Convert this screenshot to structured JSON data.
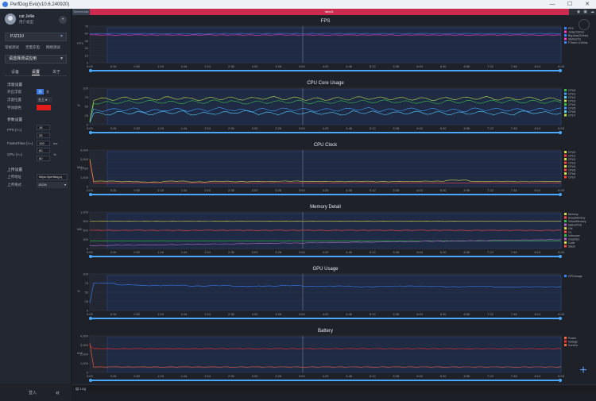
{
  "window": {
    "title": "PerfDog Evo(v10.6.240920)",
    "controls": [
      "—",
      "☐",
      "✕"
    ]
  },
  "user": {
    "name": "cat Jellie",
    "type": "用户类型"
  },
  "device": {
    "name": "PJZ110"
  },
  "modes": [
    "常规测试",
    "无需充电",
    "网络测试"
  ],
  "app_select": "请选择测试应用",
  "tabs": [
    "设备",
    "设置",
    "关于"
  ],
  "settings": {
    "float_section": "浮窗设置",
    "open_float": "开启浮窗",
    "on_label": "开",
    "off_label": "关",
    "float_pos": "浮窗位置",
    "float_pos_value": "左上",
    "font_color": "字体颜色",
    "font_color_value": "#e21b1b",
    "params_section": "参数设置",
    "fps_label": "FPS (>=)",
    "fps_value1": "18",
    "fps_value2": "25",
    "frametime_label": "FrameTime (>=)",
    "frametime_value": "100",
    "frametime_unit": "ms",
    "cpu_label": "CPU (>=)",
    "cpu_value1": "60",
    "cpu_value2": "80",
    "cpu_unit": "%",
    "upload_section": "上传设置",
    "upload_addr": "上传地址",
    "upload_addr_value": "https://perfdog.q",
    "upload_fmt": "上传格式",
    "upload_fmt_value": "JSON"
  },
  "bottom": {
    "login": "登入",
    "collapse": "«"
  },
  "toptabs": {
    "first": "Screen1ab",
    "second": "label1"
  },
  "status": {
    "log": "Log"
  },
  "time_ticks": [
    "0:00",
    "0:26",
    "0:52",
    "1:18",
    "1:44",
    "2:10",
    "2:36",
    "3:02",
    "3:28",
    "3:54",
    "4:20",
    "4:46",
    "5:12",
    "5:38",
    "6:04",
    "6:30",
    "6:56",
    "7:22",
    "7:48",
    "8:14",
    "8:28"
  ],
  "colors": {
    "accent": "#3b7be0",
    "danger": "#cc2a4e",
    "cursor_bar": "#4aa8ff"
  },
  "chart_data": [
    {
      "type": "line",
      "title": "FPS",
      "ylabel": "FPS",
      "ylim": [
        0,
        75
      ],
      "yticks": [
        "0",
        "15",
        "30",
        "45",
        "60",
        "75"
      ],
      "series": [
        {
          "name": "FPS",
          "values": [
            60,
            60,
            60,
            60,
            60,
            59,
            60,
            60,
            60,
            60,
            60,
            60,
            60,
            60,
            60,
            60,
            60,
            60,
            60,
            60,
            60
          ]
        },
        {
          "name": "Jank",
          "values": [
            57,
            57,
            57,
            57,
            57,
            57,
            57,
            57,
            57,
            57,
            57,
            57,
            57,
            57,
            57,
            57,
            57,
            57,
            57,
            57,
            57
          ]
        }
      ],
      "legend": [
        "FPS",
        "Jank(/10min)",
        "BigJank(/10min)",
        "Stutter(%)",
        "FTime>=100ms"
      ]
    },
    {
      "type": "line",
      "title": "CPU Core Usage",
      "ylabel": "%",
      "ylim": [
        0,
        100
      ],
      "yticks": [
        "0",
        "25",
        "50",
        "75",
        "100"
      ],
      "series": [
        {
          "name": "CPU0",
          "values": [
            10,
            60,
            62,
            63,
            61,
            62,
            64,
            60,
            62,
            63,
            61,
            62,
            63,
            64,
            62,
            61,
            63,
            62,
            64,
            63,
            62
          ]
        },
        {
          "name": "CPU1",
          "values": [
            8,
            40,
            42,
            38,
            41,
            40,
            43,
            39,
            41,
            42,
            40,
            41,
            43,
            40,
            42,
            41,
            39,
            42,
            41,
            40,
            42
          ]
        },
        {
          "name": "CPU2",
          "values": [
            6,
            30,
            33,
            31,
            34,
            30,
            32,
            35,
            31,
            33,
            32,
            30,
            34,
            31,
            33,
            32,
            31,
            33,
            30,
            34,
            32
          ]
        },
        {
          "name": "CPU3",
          "values": [
            12,
            70,
            72,
            71,
            73,
            70,
            72,
            71,
            73,
            72,
            70,
            71,
            73,
            72,
            71,
            70,
            72,
            73,
            71,
            72,
            70
          ]
        }
      ],
      "legend": [
        "CPU0",
        "CPU1",
        "CPU2",
        "CPU3",
        "CPU4",
        "CPU5",
        "CPU6",
        "CPU7"
      ]
    },
    {
      "type": "line",
      "title": "CPU Clock",
      "ylabel": "MHz",
      "ylim": [
        0,
        4000
      ],
      "yticks": [
        "0",
        "1,000",
        "2,000",
        "3,000",
        "4,000"
      ],
      "series": [
        {
          "name": "CPU0",
          "values": [
            3000,
            600,
            550,
            500,
            600,
            520,
            580,
            540,
            560,
            600,
            570,
            550,
            580,
            540,
            560,
            590,
            700,
            560,
            580,
            550,
            560
          ]
        },
        {
          "name": "CPU4",
          "values": [
            2800,
            400,
            380,
            420,
            390,
            410,
            400,
            380,
            420,
            410,
            390,
            400,
            420,
            380,
            410,
            400,
            390,
            410,
            400,
            390,
            400
          ]
        }
      ],
      "legend": [
        "CPU0",
        "CPU1",
        "CPU2",
        "CPU3",
        "CPU4",
        "CPU5",
        "CPU6",
        "CPU7"
      ]
    },
    {
      "type": "line",
      "title": "Memory Detail",
      "ylabel": "MB",
      "ylim": [
        0,
        1200
      ],
      "yticks": [
        "0",
        "300",
        "600",
        "900",
        "1,200"
      ],
      "series": [
        {
          "name": "Memory",
          "values": [
            900,
            900,
            900,
            900,
            900,
            900,
            900,
            900,
            900,
            900,
            900,
            900,
            900,
            900,
            900,
            900,
            900,
            900,
            900,
            900,
            900
          ]
        },
        {
          "name": "NativePSS",
          "values": [
            600,
            600,
            600,
            600,
            600,
            600,
            600,
            600,
            600,
            600,
            600,
            600,
            600,
            600,
            600,
            600,
            600,
            600,
            600,
            600,
            600
          ]
        },
        {
          "name": "GL",
          "values": [
            250,
            250,
            250,
            250,
            250,
            250,
            250,
            250,
            250,
            250,
            250,
            250,
            250,
            250,
            250,
            250,
            250,
            250,
            250,
            250,
            250
          ]
        },
        {
          "name": "Graphics",
          "values": [
            100,
            100,
            110,
            120,
            130,
            140,
            150,
            160,
            170,
            180,
            190,
            200,
            210,
            220,
            230,
            240,
            250,
            260,
            270,
            280,
            290
          ]
        }
      ],
      "legend": [
        "Memory",
        "SwapMemory",
        "VirtualMemory",
        "NativePSS",
        "Gfx",
        "GL",
        "Unknown",
        "Graphics",
        "Code",
        "Stack"
      ]
    },
    {
      "type": "line",
      "title": "GPU Usage",
      "ylabel": "%",
      "ylim": [
        0,
        100
      ],
      "yticks": [
        "0",
        "25",
        "50",
        "75",
        "100"
      ],
      "series": [
        {
          "name": "GPU",
          "values": [
            20,
            75,
            70,
            68,
            69,
            67,
            68,
            66,
            67,
            68,
            66,
            67,
            65,
            66,
            67,
            66,
            65,
            66,
            64,
            65,
            65
          ]
        }
      ],
      "legend": [
        "GPUUsage"
      ]
    },
    {
      "type": "line",
      "title": "Battery",
      "ylabel": "mW",
      "ylim": [
        0,
        4000
      ],
      "yticks": [
        "0",
        "1,000",
        "2,000",
        "3,000",
        "4,000"
      ],
      "series": [
        {
          "name": "Power",
          "values": [
            3200,
            600,
            600,
            600,
            600,
            600,
            600,
            600,
            600,
            600,
            600,
            600,
            600,
            600,
            600,
            600,
            600,
            600,
            600,
            600,
            600
          ]
        },
        {
          "name": "Voltage",
          "values": [
            2900,
            2600,
            2600,
            2600,
            2600,
            2600,
            2600,
            2600,
            2600,
            2600,
            2600,
            2600,
            2600,
            2600,
            2600,
            2600,
            2600,
            2600,
            2600,
            2600,
            2600
          ]
        }
      ],
      "legend": [
        "Power",
        "Voltage",
        "Current"
      ]
    }
  ]
}
